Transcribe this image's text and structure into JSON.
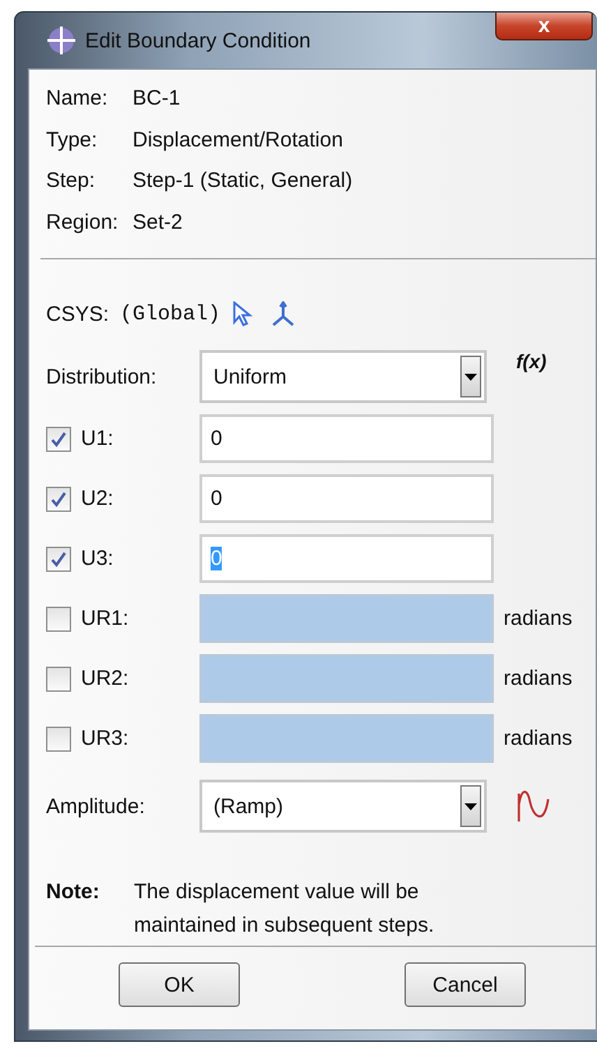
{
  "window": {
    "title": "Edit Boundary Condition",
    "close": "x"
  },
  "info": [
    {
      "label": "Name:",
      "value": "BC-1"
    },
    {
      "label": "Type:",
      "value": "Displacement/Rotation"
    },
    {
      "label": "Step:",
      "value": "Step-1 (Static, General)"
    },
    {
      "label": "Region:",
      "value": "Set-2"
    }
  ],
  "csys": {
    "label": "CSYS:",
    "value": "(Global)"
  },
  "distribution": {
    "label": "Distribution:",
    "value": "Uniform",
    "function": "f(x)"
  },
  "components": [
    {
      "label": "U1:",
      "checked": true,
      "value": "0",
      "text_selected": false,
      "disabled": false
    },
    {
      "label": "U2:",
      "checked": true,
      "value": "0",
      "text_selected": false,
      "disabled": false
    },
    {
      "label": "U3:",
      "checked": true,
      "value": "0",
      "text_selected": true,
      "disabled": false
    },
    {
      "label": "UR1:",
      "checked": false,
      "disabled": true,
      "unit": "radians"
    },
    {
      "label": "UR2:",
      "checked": false,
      "disabled": true,
      "unit": "radians"
    },
    {
      "label": "UR3:",
      "checked": false,
      "disabled": true,
      "unit": "radians"
    }
  ],
  "amplitude": {
    "label": "Amplitude:",
    "value": "(Ramp)"
  },
  "note": {
    "label": "Note:",
    "text": "The displacement value will be maintained in subsequent steps."
  },
  "buttons": [
    "OK",
    "Cancel"
  ]
}
